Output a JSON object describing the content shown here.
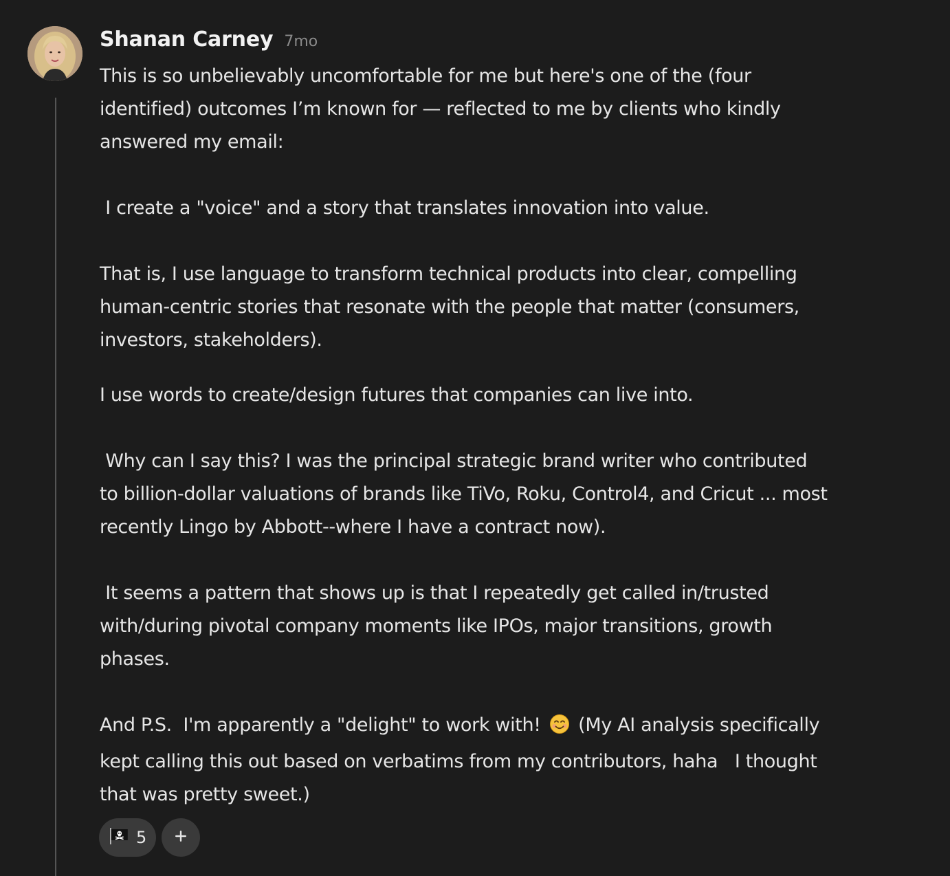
{
  "comment": {
    "author": "Shanan Carney",
    "timestamp": "7mo",
    "lines": [
      "This is so unbelievably uncomfortable for me but here's one of the (four",
      "identified) outcomes I’m known for — reflected to me by clients who kindly",
      "answered my email:",
      " I create a \"voice\" and a story that translates innovation into value.",
      "That is, I use language to transform technical products into clear, compelling",
      "human-centric stories that resonate with the people that matter (consumers,",
      "investors, stakeholders).",
      "I use words to create/design futures that companies can live into.",
      " Why can I say this? I was the principal strategic brand writer who contributed",
      "to billion-dollar valuations of brands like TiVo, Roku, Control4, and Cricut ... most",
      "recently Lingo by Abbott--where I have a contract now).",
      " It seems a pattern that shows up is that I repeatedly get called in/trusted",
      "with/during pivotal company moments like IPOs, major transitions, growth",
      "phases."
    ],
    "last_paragraph": {
      "line1_before_emoji": "And P.S.  I'm apparently a \"delight\" to work with! ",
      "line1_after_emoji": " (My AI analysis specifically",
      "line2": "kept calling this out based on verbatims from my contributors, haha   I thought",
      "line3": "that was pretty sweet.)"
    },
    "inline_emoji_icon": "smiling-face-emoji-icon"
  },
  "reactions": {
    "items": [
      {
        "icon": "pirate-flag-icon",
        "count": "5"
      }
    ],
    "add_icon": "plus-icon"
  },
  "colors": {
    "background": "#1c1c1c",
    "text": "#e6e6e6",
    "muted": "#8a8a8a",
    "pill": "#3a3a3a",
    "thread_line": "#555555"
  }
}
